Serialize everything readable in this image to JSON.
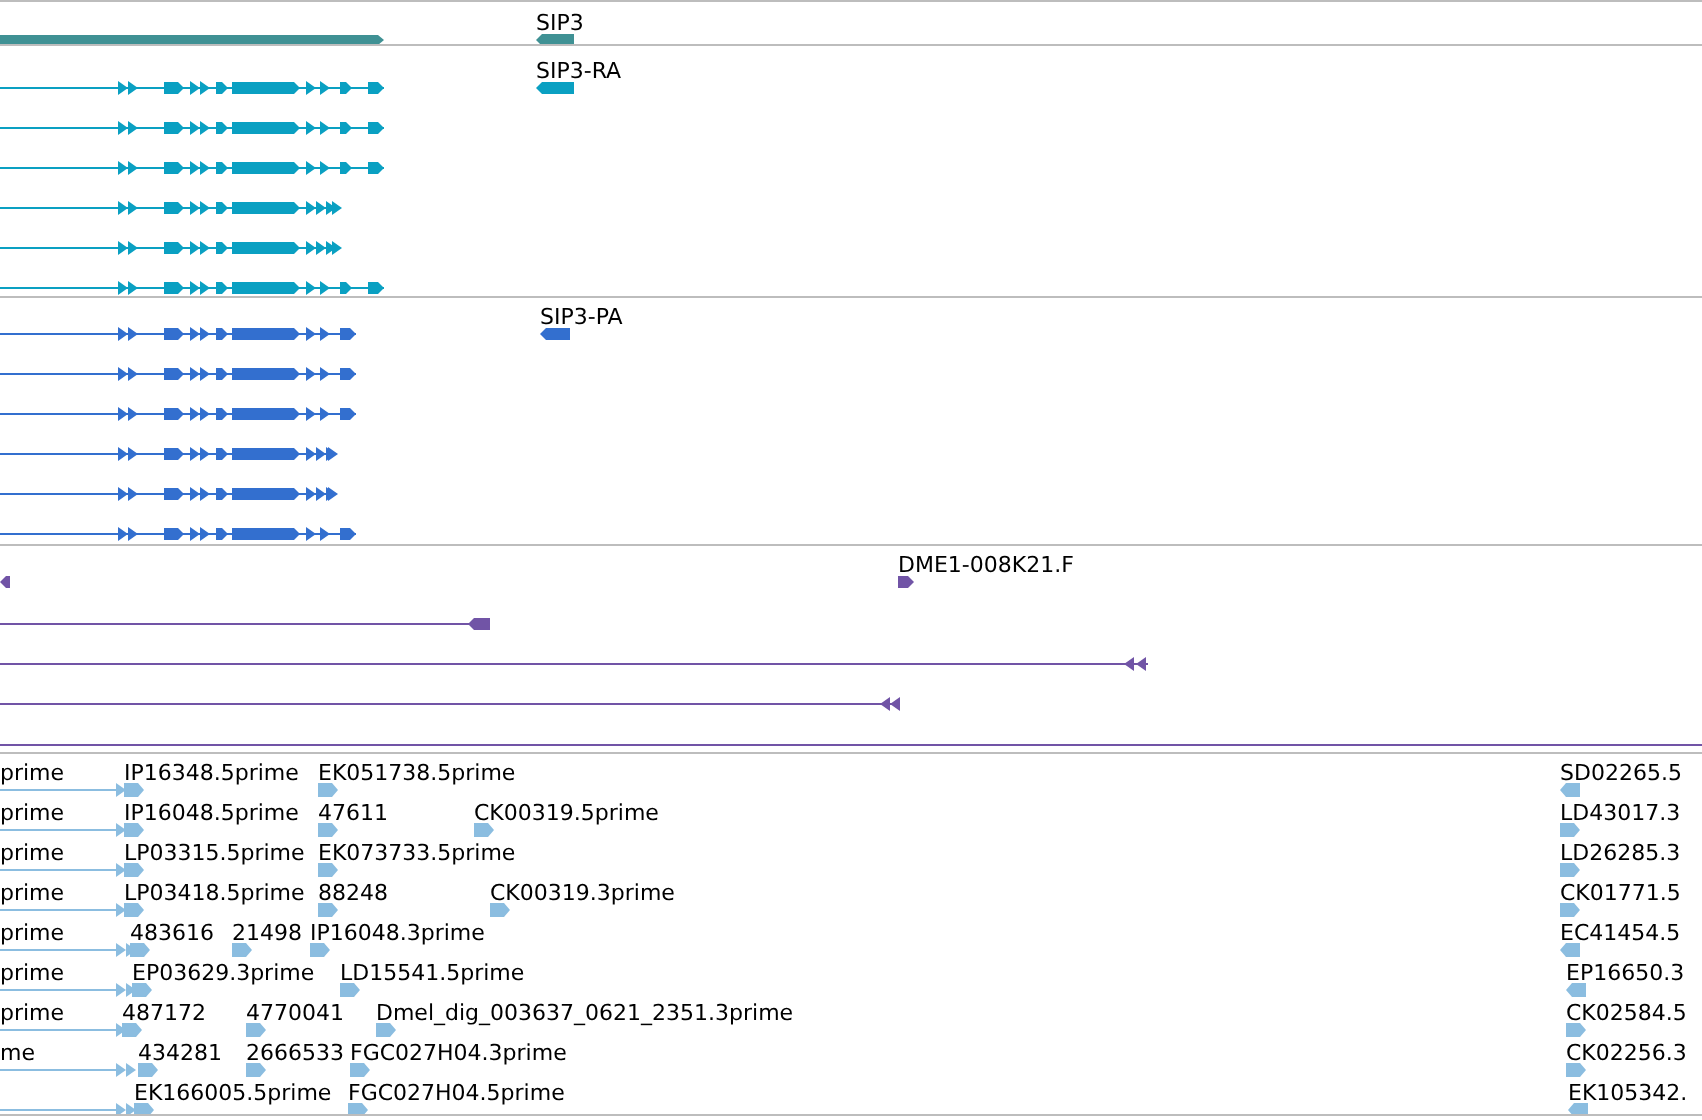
{
  "tracks": [
    {
      "kind": "gene",
      "color": "#3f9194",
      "features": [
        {
          "reverse": false
        },
        {
          "label": "SIP3",
          "reverse": true
        }
      ]
    },
    {
      "kind": "transcript",
      "color": "#0aa0c2",
      "features": [
        {
          "reverse": false
        },
        {
          "reverse": false
        },
        {
          "reverse": false
        },
        {
          "reverse": false
        },
        {
          "reverse": false
        },
        {
          "reverse": false
        },
        {
          "label": "SIP3-RA",
          "reverse": true
        }
      ]
    },
    {
      "kind": "transcript",
      "color": "#336fcf",
      "features": [
        {
          "reverse": false
        },
        {
          "reverse": false
        },
        {
          "reverse": false
        },
        {
          "reverse": false
        },
        {
          "reverse": false
        },
        {
          "reverse": false
        },
        {
          "label": "SIP3-PA",
          "reverse": true
        }
      ]
    },
    {
      "kind": "clone",
      "color": "#7154a6",
      "features": [
        {
          "reverse": true
        },
        {
          "label": "DME1-008K21.F",
          "reverse": false
        },
        {
          "reverse": true
        },
        {
          "reverse": true
        },
        {
          "reverse": true
        }
      ]
    },
    {
      "kind": "est",
      "color": "#8bbde0",
      "features": [
        {
          "label": "prime",
          "reverse": false
        },
        {
          "label": "IP16348.5prime",
          "reverse": false
        },
        {
          "label": "EK051738.5prime",
          "reverse": false
        },
        {
          "label": "SD02265.5",
          "reverse": true
        },
        {
          "label": "prime",
          "reverse": false
        },
        {
          "label": "IP16048.5prime",
          "reverse": false
        },
        {
          "label": "47611",
          "reverse": false
        },
        {
          "label": "CK00319.5prime",
          "reverse": false
        },
        {
          "label": "LD43017.3",
          "reverse": false
        },
        {
          "label": "prime",
          "reverse": false
        },
        {
          "label": "LP03315.5prime",
          "reverse": false
        },
        {
          "label": "EK073733.5prime",
          "reverse": false
        },
        {
          "label": "LD26285.3",
          "reverse": false
        },
        {
          "label": "prime",
          "reverse": false
        },
        {
          "label": "LP03418.5prime",
          "reverse": false
        },
        {
          "label": "88248",
          "reverse": false
        },
        {
          "label": "CK00319.3prime",
          "reverse": false
        },
        {
          "label": "CK01771.5",
          "reverse": false
        },
        {
          "label": "prime",
          "reverse": false
        },
        {
          "label": "483616",
          "reverse": false
        },
        {
          "label": "21498",
          "reverse": false
        },
        {
          "label": "IP16048.3prime",
          "reverse": false
        },
        {
          "label": "EC41454.5",
          "reverse": true
        },
        {
          "label": "prime",
          "reverse": false
        },
        {
          "label": "EP03629.3prime",
          "reverse": false
        },
        {
          "label": "LD15541.5prime",
          "reverse": false
        },
        {
          "label": "EP16650.3",
          "reverse": true
        },
        {
          "label": "prime",
          "reverse": false
        },
        {
          "label": "487172",
          "reverse": false
        },
        {
          "label": "4770041",
          "reverse": false
        },
        {
          "label": "Dmel_dig_003637_0621_2351.3prime",
          "reverse": false
        },
        {
          "label": "CK02584.5",
          "reverse": false
        },
        {
          "label": "me",
          "reverse": false
        },
        {
          "label": "434281",
          "reverse": false
        },
        {
          "label": "2666533",
          "reverse": false
        },
        {
          "label": "FGC027H04.3prime",
          "reverse": false
        },
        {
          "label": "CK02256.3",
          "reverse": false
        },
        {
          "reverse": false
        },
        {
          "label": "EK166005.5prime",
          "reverse": false
        },
        {
          "label": "FGC027H04.5prime",
          "reverse": false
        },
        {
          "label": "EK105342.",
          "reverse": true
        }
      ]
    }
  ]
}
